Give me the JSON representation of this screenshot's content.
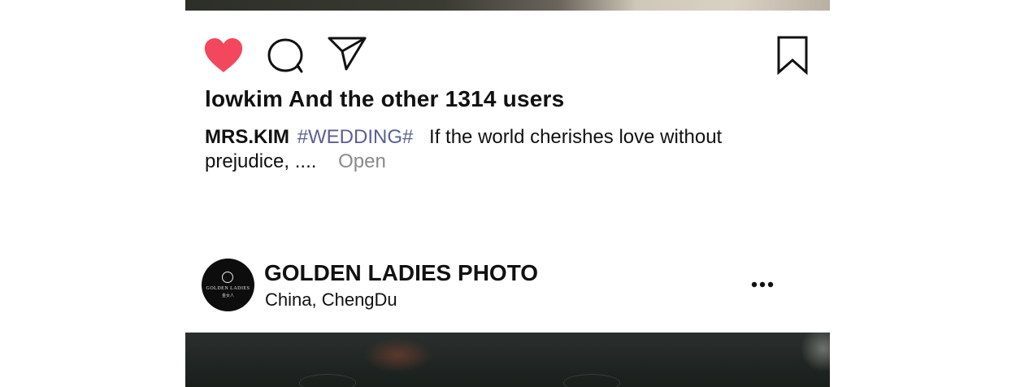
{
  "post": {
    "likes_text": "lowkim And the other 1314 users",
    "caption": {
      "author": "MRS.KIM",
      "hashtag": "#WEDDING#",
      "text": "If the world cherishes love without prejudice, ....",
      "open_label": "Open"
    },
    "liked": true,
    "colors": {
      "like": "#f2475c",
      "hashtag": "#5a5f96",
      "open": "#8a8a8a"
    }
  },
  "actions": {
    "like_icon": "heart-icon",
    "comment_icon": "comment-icon",
    "share_icon": "send-icon",
    "save_icon": "bookmark-icon"
  },
  "next_post": {
    "account_name": "GOLDEN LADIES PHOTO",
    "location": "China,  ChengDu",
    "avatar_logo_text": "GOLDEN LADIES",
    "avatar_logo_sub": "金女人",
    "more_icon": "more-dots-icon"
  }
}
